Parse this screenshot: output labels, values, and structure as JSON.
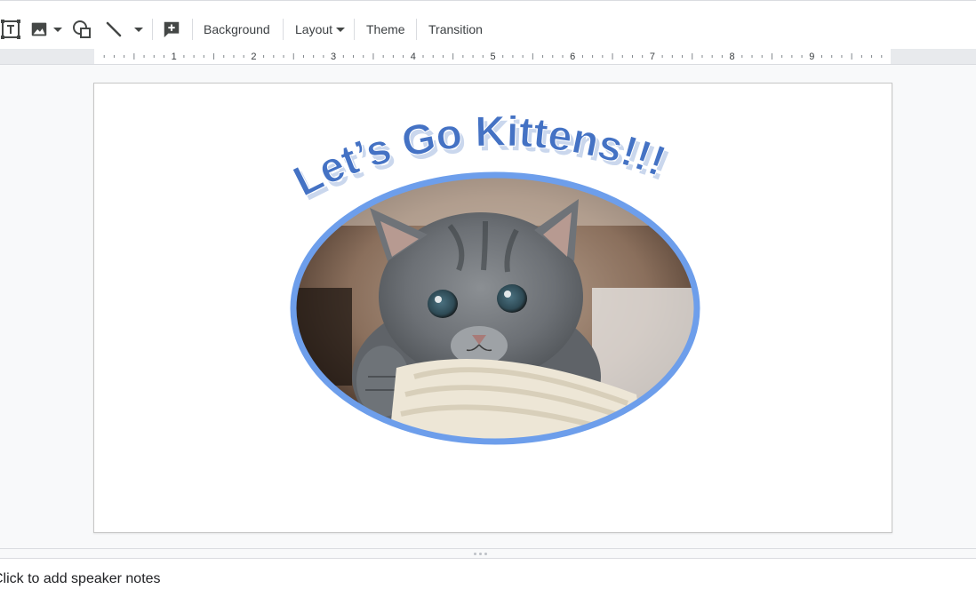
{
  "toolbar": {
    "background_label": "Background",
    "layout_label": "Layout",
    "theme_label": "Theme",
    "transition_label": "Transition",
    "icons": [
      "text-box-icon",
      "image-icon",
      "shape-icon",
      "line-icon",
      "add-comment-icon"
    ]
  },
  "ruler": {
    "numbers": [
      "1",
      "2",
      "3",
      "4",
      "5",
      "6",
      "7",
      "8",
      "9"
    ]
  },
  "slide": {
    "title": "Let’s Go Kittens!!!",
    "title_color": "#4472c4",
    "frame_color": "#6d9eeb"
  },
  "notes": {
    "placeholder": "Click to add speaker notes"
  }
}
